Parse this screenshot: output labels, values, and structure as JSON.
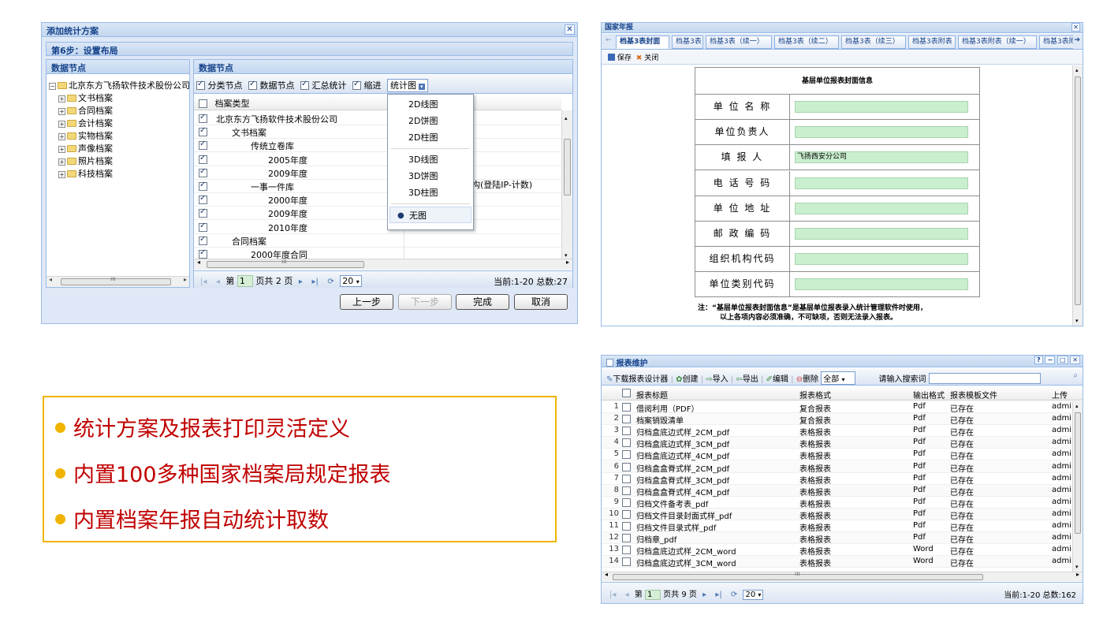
{
  "wizard": {
    "title": "添加统计方案",
    "step": "第6步：设置布局",
    "left_header": "数据节点",
    "right_header": "数据节点",
    "tree_root": "北京东方飞扬软件技术股份公司",
    "tree_items": [
      "文书档案",
      "合同档案",
      "会计档案",
      "实物档案",
      "声像档案",
      "照片档案",
      "科技档案"
    ],
    "toolbar": {
      "opt1": "分类节点",
      "opt2": "数据节点",
      "opt3": "汇总统计",
      "opt4": "缩进",
      "chart_menu": "统计图"
    },
    "grid_header": "档案类型",
    "grid_rows": [
      {
        "text": "北京东方飞扬软件技术股份公司",
        "indent": 0
      },
      {
        "text": "文书档案",
        "indent": 1
      },
      {
        "text": "传统立卷库",
        "indent": 2
      },
      {
        "text": "2005年度",
        "indent": 3
      },
      {
        "text": "2009年度",
        "indent": 3
      },
      {
        "text": "一事一件库",
        "indent": 2
      },
      {
        "text": "2000年度",
        "indent": 3
      },
      {
        "text": "2009年度",
        "indent": 3
      },
      {
        "text": "2010年度",
        "indent": 3
      },
      {
        "text": "合同档案",
        "indent": 1
      },
      {
        "text": "2000年度合同",
        "indent": 2
      }
    ],
    "side_text": "构(登陆IP-计数)",
    "chart_options": [
      "2D线图",
      "2D饼图",
      "2D柱图",
      "3D线图",
      "3D饼图",
      "3D柱图",
      "无图"
    ],
    "pager": {
      "page_prefix": "第",
      "page_num": "1",
      "page_suffix": "页共 2 页",
      "page_size": "20",
      "status": "当前:1-20 总数:27"
    },
    "buttons": {
      "prev": "上一步",
      "next": "下一步",
      "finish": "完成",
      "cancel": "取消"
    }
  },
  "annual": {
    "title": "国家年报",
    "tabs": [
      "档基3表封面",
      "档基3表",
      "档基3表（续一）",
      "档基3表（续二）",
      "档基3表（续三）",
      "档基3表附表",
      "档基3表附表（续一）",
      "档基3表附"
    ],
    "save": "保存",
    "close": "关闭",
    "form_title": "基层单位报表封面信息",
    "fields": [
      {
        "label": "单 位 名 称",
        "value": ""
      },
      {
        "label": "单位负责人",
        "value": ""
      },
      {
        "label": "填 报 人",
        "value": "飞扬西安分公司"
      },
      {
        "label": "电 话 号 码",
        "value": ""
      },
      {
        "label": "单 位 地 址",
        "value": ""
      },
      {
        "label": "邮 政 编 码",
        "value": ""
      },
      {
        "label": "组织机构代码",
        "value": ""
      },
      {
        "label": "单位类别代码",
        "value": ""
      }
    ],
    "note1": "注：“基层单位报表封面信息”是基层单位报表录入统计管理软件时使用，",
    "note2": "以上各项内容必须准确，不可缺项，否则无法录入报表。"
  },
  "report": {
    "title": "报表维护",
    "toolbar": {
      "download": "下载报表设计器",
      "create": "创建",
      "import": "导入",
      "export": "导出",
      "edit": "编辑",
      "delete": "删除",
      "filter": "全部",
      "search_label": "请输入搜索词"
    },
    "columns": [
      "报表标题",
      "报表格式",
      "输出格式",
      "报表模板文件",
      "上传"
    ],
    "rows": [
      [
        "1",
        "借阅利用（PDF）",
        "复合报表",
        "Pdf",
        "已存在",
        "admi"
      ],
      [
        "2",
        "档案销毁清单",
        "复合报表",
        "Pdf",
        "已存在",
        "admi"
      ],
      [
        "3",
        "归档盒底边式样_2CM_pdf",
        "表格报表",
        "Pdf",
        "已存在",
        "admi"
      ],
      [
        "4",
        "归档盒底边式样_3CM_pdf",
        "表格报表",
        "Pdf",
        "已存在",
        "admi"
      ],
      [
        "5",
        "归档盒底边式样_4CM_pdf",
        "表格报表",
        "Pdf",
        "已存在",
        "admi"
      ],
      [
        "6",
        "归档盒盒脊式样_2CM_pdf",
        "表格报表",
        "Pdf",
        "已存在",
        "admi"
      ],
      [
        "7",
        "归档盒盒脊式样_3CM_pdf",
        "表格报表",
        "Pdf",
        "已存在",
        "admi"
      ],
      [
        "8",
        "归档盒盒脊式样_4CM_pdf",
        "表格报表",
        "Pdf",
        "已存在",
        "admi"
      ],
      [
        "9",
        "归档文件备考表_pdf",
        "表格报表",
        "Pdf",
        "已存在",
        "admi"
      ],
      [
        "10",
        "归档文件目录封面式样_pdf",
        "表格报表",
        "Pdf",
        "已存在",
        "admi"
      ],
      [
        "11",
        "归档文件目录式样_pdf",
        "表格报表",
        "Pdf",
        "已存在",
        "admi"
      ],
      [
        "12",
        "归档章_pdf",
        "表格报表",
        "Pdf",
        "已存在",
        "admi"
      ],
      [
        "13",
        "归档盒底边式样_2CM_word",
        "表格报表",
        "Word",
        "已存在",
        "admi"
      ],
      [
        "14",
        "归档盒底边式样_3CM_word",
        "表格报表",
        "Word",
        "已存在",
        "admi"
      ]
    ],
    "pager": {
      "page_prefix": "第",
      "page_num": "1",
      "page_suffix": "页共 9 页",
      "page_size": "20",
      "status": "当前:1-20 总数:162"
    }
  },
  "bullets": [
    "统计方案及报表打印灵活定义",
    "内置100多种国家档案局规定报表",
    "内置档案年报自动统计取数"
  ]
}
